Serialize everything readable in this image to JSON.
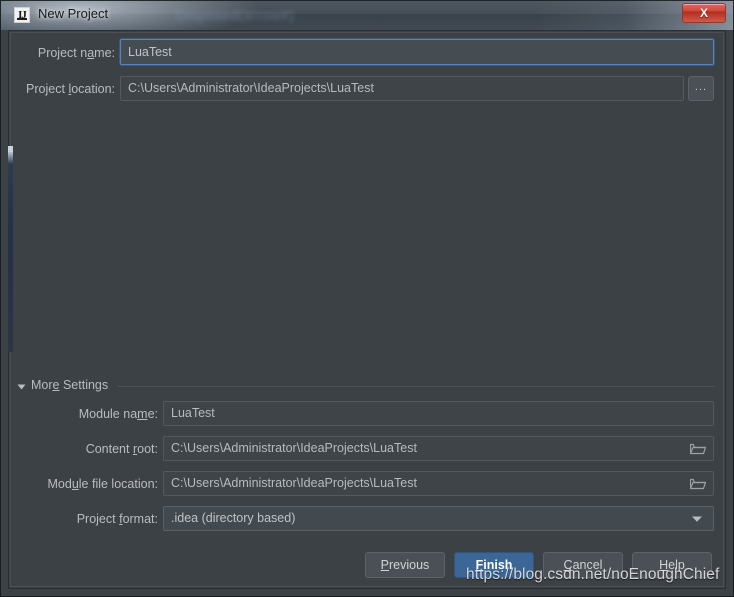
{
  "window": {
    "title": "New Project",
    "ghost_title": "Disposed(arrow#)",
    "app_icon": "intellij-idea-icon",
    "close_label": "X"
  },
  "form": {
    "project_name": {
      "label_before": "Project n",
      "label_mnemonic": "a",
      "label_after": "me:",
      "value": "LuaTest"
    },
    "project_location": {
      "label_before": "Project ",
      "label_mnemonic": "l",
      "label_after": "ocation:",
      "value": "C:\\Users\\Administrator\\IdeaProjects\\LuaTest",
      "browse_label": "..."
    }
  },
  "more_settings": {
    "label_before": "Mor",
    "label_mnemonic": "e",
    "label_after": " Settings",
    "expanded": true,
    "rows": [
      {
        "name": "module-name",
        "label_before": "Module na",
        "label_mnemonic": "m",
        "label_after": "e:",
        "value": "LuaTest",
        "trailing_icon": ""
      },
      {
        "name": "content-root",
        "label_before": "Content ",
        "label_mnemonic": "r",
        "label_after": "oot:",
        "value": "C:\\Users\\Administrator\\IdeaProjects\\LuaTest",
        "trailing_icon": "folder-icon"
      },
      {
        "name": "module-file-location",
        "label_before": "Mod",
        "label_mnemonic": "u",
        "label_after": "le file location:",
        "value": "C:\\Users\\Administrator\\IdeaProjects\\LuaTest",
        "trailing_icon": "folder-icon"
      },
      {
        "name": "project-format",
        "label_before": "Project ",
        "label_mnemonic": "f",
        "label_after": "ormat:",
        "value": ".idea (directory based)",
        "trailing_icon": "chevron-down-icon"
      }
    ]
  },
  "buttons": {
    "previous": {
      "before": "",
      "mnemonic": "P",
      "after": "revious"
    },
    "finish": {
      "before": "",
      "mnemonic": "F",
      "after": "inish"
    },
    "cancel": {
      "before": "",
      "mnemonic": "C",
      "after": "ancel"
    },
    "help": {
      "before": "",
      "mnemonic": "H",
      "after": "elp"
    }
  },
  "watermark": {
    "text": "https://blog.csdn.net/noEnoughChief"
  },
  "colors": {
    "dialog_bg": "#3c4145",
    "field_bg": "#434a4f",
    "field_border": "#5a6166",
    "focus_border": "#4f86c5",
    "primary_button": "#3b6695",
    "text": "#b9bcbf",
    "close_button": "#cf4436"
  }
}
